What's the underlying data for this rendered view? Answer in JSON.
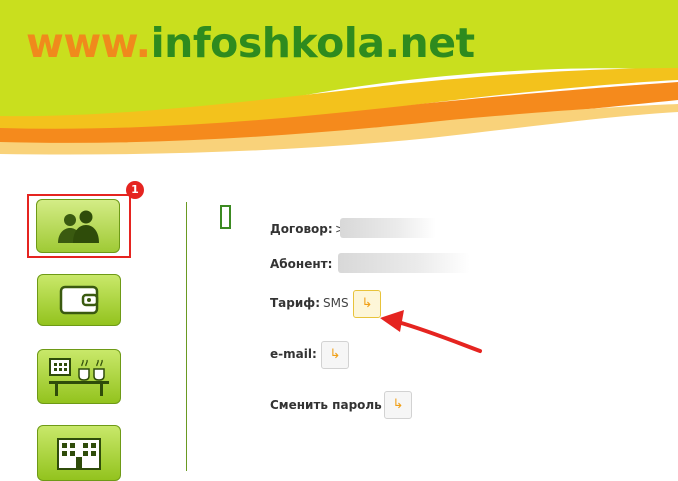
{
  "site": {
    "logo_prefix": "www.",
    "logo_domain": "infoshkola.net"
  },
  "nav": {
    "badge": "1",
    "items": [
      {
        "icon": "users-icon"
      },
      {
        "icon": "wallet-icon"
      },
      {
        "icon": "canteen-icon"
      },
      {
        "icon": "school-building-icon"
      }
    ]
  },
  "profile": {
    "contract_label": "Договор:",
    "contract_value_prefix": ">",
    "subscriber_label": "Абонент:",
    "tariff_label": "Тариф:",
    "tariff_value": "SMS",
    "email_label": "e-mail:",
    "change_password_label": "Сменить пароль",
    "edit_glyph": "↳"
  },
  "colors": {
    "accent_green": "#2e8b1e",
    "logo_orange": "#f08a1c",
    "highlight_red": "#e52420",
    "nav_green": "#93c31e"
  }
}
